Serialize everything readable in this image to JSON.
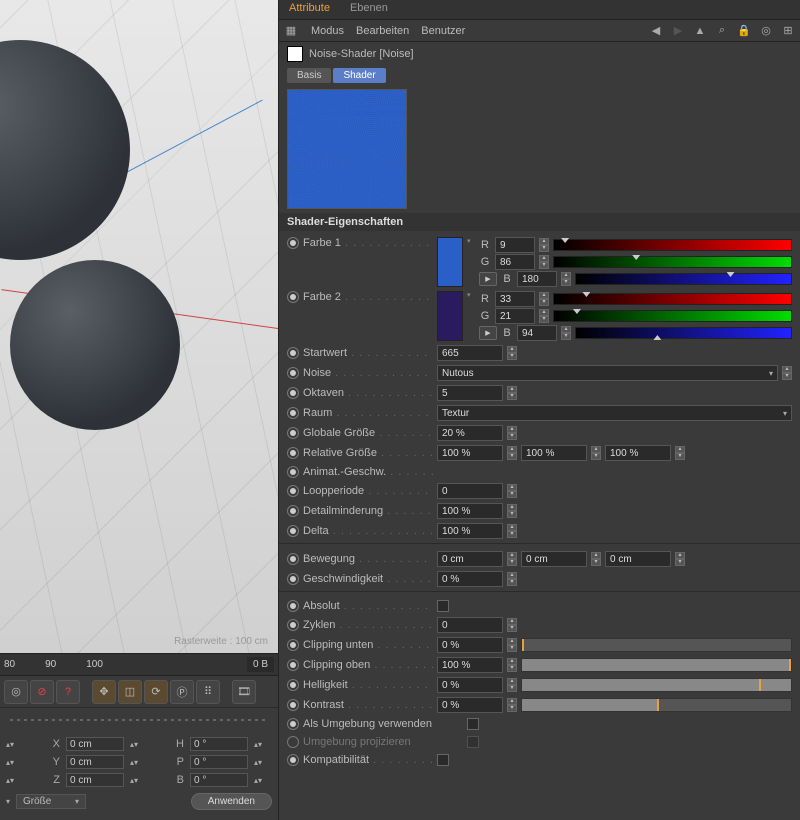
{
  "tabs": {
    "attribute": "Attribute",
    "ebenen": "Ebenen"
  },
  "menu": {
    "modus": "Modus",
    "bearbeiten": "Bearbeiten",
    "benutzer": "Benutzer"
  },
  "title": "Noise-Shader [Noise]",
  "subtabs": {
    "basis": "Basis",
    "shader": "Shader"
  },
  "section": "Shader-Eigenschaften",
  "color1": {
    "label": "Farbe 1",
    "r_lbl": "R",
    "g_lbl": "G",
    "b_lbl": "B",
    "r": "9",
    "g": "86",
    "b": "180",
    "swatch": "#2a5fc8"
  },
  "color2": {
    "label": "Farbe 2",
    "r_lbl": "R",
    "g_lbl": "G",
    "b_lbl": "B",
    "r": "33",
    "g": "21",
    "b": "94",
    "swatch": "#2a1a60"
  },
  "startwert": {
    "label": "Startwert",
    "val": "665"
  },
  "noise": {
    "label": "Noise",
    "val": "Nutous"
  },
  "oktaven": {
    "label": "Oktaven",
    "val": "5"
  },
  "raum": {
    "label": "Raum",
    "val": "Textur"
  },
  "globsize": {
    "label": "Globale Größe",
    "val": "20 %"
  },
  "relsize": {
    "label": "Relative Größe",
    "v1": "100 %",
    "v2": "100 %",
    "v3": "100 %"
  },
  "animspeed": {
    "label": "Animat.-Geschw."
  },
  "loop": {
    "label": "Loopperiode",
    "val": "0"
  },
  "detail": {
    "label": "Detailminderung",
    "val": "100 %"
  },
  "delta": {
    "label": "Delta",
    "val": "100 %"
  },
  "bewegung": {
    "label": "Bewegung",
    "v1": "0 cm",
    "v2": "0 cm",
    "v3": "0 cm"
  },
  "geschw": {
    "label": "Geschwindigkeit",
    "val": "0 %"
  },
  "absolut": {
    "label": "Absolut"
  },
  "zyklen": {
    "label": "Zyklen",
    "val": "0"
  },
  "clip_low": {
    "label": "Clipping unten",
    "val": "0 %"
  },
  "clip_high": {
    "label": "Clipping oben",
    "val": "100 %"
  },
  "hell": {
    "label": "Helligkeit",
    "val": "0 %"
  },
  "kontrast": {
    "label": "Kontrast",
    "val": "0 %"
  },
  "umgebung": {
    "label": "Als Umgebung verwenden"
  },
  "projizieren": {
    "label": "Umgebung projizieren"
  },
  "kompat": {
    "label": "Kompatibilität"
  },
  "ruler": {
    "r1": "80",
    "r2": "90",
    "r3": "100",
    "rb": "0 B"
  },
  "coords": {
    "x": "X",
    "y": "Y",
    "z": "Z",
    "h": "H",
    "p": "P",
    "b": "B",
    "xval": "0 cm",
    "yval": "0 cm",
    "zval": "0 cm",
    "hval": "0 °",
    "pval": "0 °",
    "bval": "0 °",
    "size": "Größe",
    "apply": "Anwenden"
  },
  "viewport_info": "Rasterweite : 100 cm"
}
